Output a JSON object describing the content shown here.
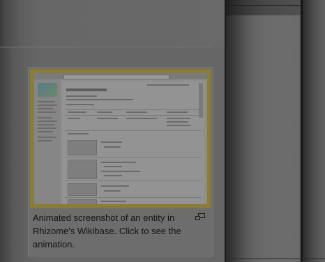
{
  "figure": {
    "caption": "Animated screenshot of an entity in Rhizome's Wikibase. Click to see the animation.",
    "enlarge_icon": "magnify-clip-icon",
    "thumbnail_alt": "Animated screenshot of an entity in Rhizome's Wikibase"
  },
  "colors": {
    "frame_border": "#857733",
    "caption_text": "#141414",
    "overlay_dark": "#555555"
  }
}
